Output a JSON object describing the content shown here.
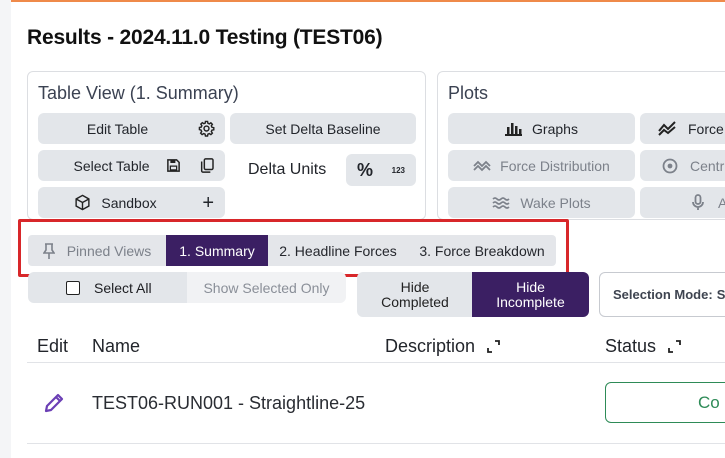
{
  "page_title": "Results - 2024.11.0 Testing (TEST06)",
  "table_view": {
    "title": "Table View (1. Summary)",
    "edit_table": "Edit Table",
    "set_delta_baseline": "Set Delta Baseline",
    "select_table": "Select Table",
    "delta_units": "Delta Units",
    "percent_symbol": "%",
    "number_symbol": "123",
    "sandbox": "Sandbox"
  },
  "plots": {
    "title": "Plots",
    "graphs": "Graphs",
    "force": "Force",
    "force_distribution": "Force Distribution",
    "centre": "Centr",
    "wake_plots": "Wake Plots",
    "audio": "A"
  },
  "pinned_views": {
    "label": "Pinned Views",
    "items": [
      {
        "label": "1. Summary",
        "active": true
      },
      {
        "label": "2. Headline Forces",
        "active": false
      },
      {
        "label": "3. Force Breakdown",
        "active": false
      }
    ]
  },
  "selection": {
    "select_all": "Select All",
    "show_selected_only": "Show Selected Only",
    "hide_completed": "Hide Completed",
    "hide_incomplete": "Hide Incomplete",
    "selection_mode_label": "Selection Mode:",
    "selection_mode_value": "S"
  },
  "table": {
    "headers": {
      "edit": "Edit",
      "name": "Name",
      "description": "Description",
      "status": "Status"
    },
    "rows": [
      {
        "name": "TEST06-RUN001 - Straightline-25",
        "status": "Co"
      }
    ]
  },
  "colors": {
    "accent": "#3b1f63",
    "highlight": "#d8272a",
    "top_border": "#ef8a4a",
    "status_green": "#2e8b57"
  }
}
